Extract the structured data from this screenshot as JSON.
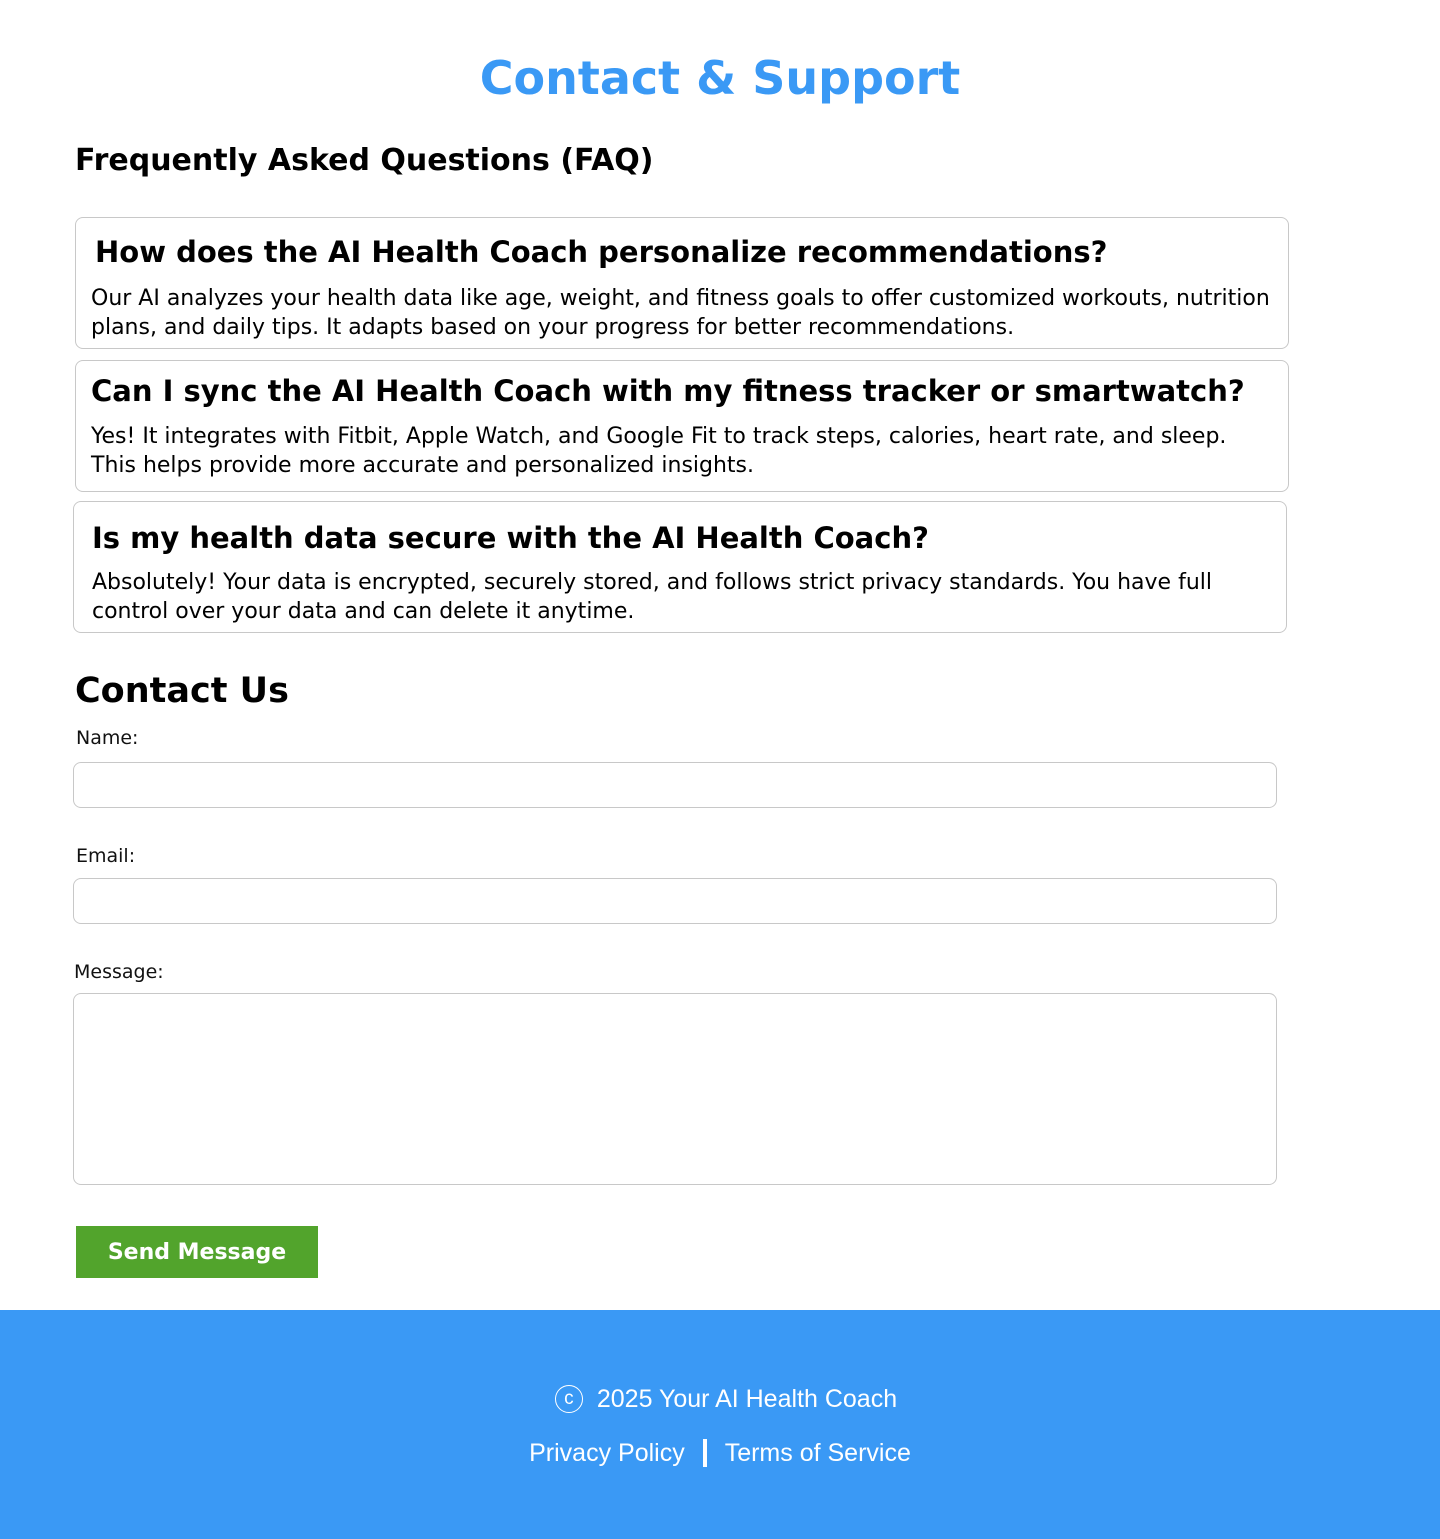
{
  "page": {
    "title": "Contact & Support",
    "accent_color": "#3a99f5",
    "button_color": "#52a42c"
  },
  "faq": {
    "heading": "Frequently Asked Questions (FAQ)",
    "items": [
      {
        "question": "How does the AI Health Coach personalize recommendations?",
        "answer": "Our AI analyzes your health data like age, weight, and fitness goals to offer customized workouts, nutrition plans, and daily tips. It adapts based on your progress for better recommendations."
      },
      {
        "question": "Can I sync the AI Health Coach with my fitness tracker or smartwatch?",
        "answer": "Yes! It integrates with Fitbit, Apple Watch, and Google Fit to track steps, calories, heart rate, and sleep. This helps provide more accurate and personalized insights."
      },
      {
        "question": "Is my health data secure with the AI Health Coach?",
        "answer": "Absolutely! Your data is encrypted, securely stored, and follows strict privacy standards. You have full control over your data and can delete it anytime."
      }
    ]
  },
  "contact": {
    "heading": "Contact Us",
    "name_label": "Name:",
    "name_value": "",
    "email_label": "Email:",
    "email_value": "",
    "message_label": "Message:",
    "message_value": "",
    "submit_label": "Send Message"
  },
  "footer": {
    "copyright_icon": "copyright-icon",
    "copyright_glyph": "c",
    "copyright_text": "2025 Your AI Health Coach",
    "links": [
      "Privacy Policy",
      "Terms of Service"
    ]
  }
}
